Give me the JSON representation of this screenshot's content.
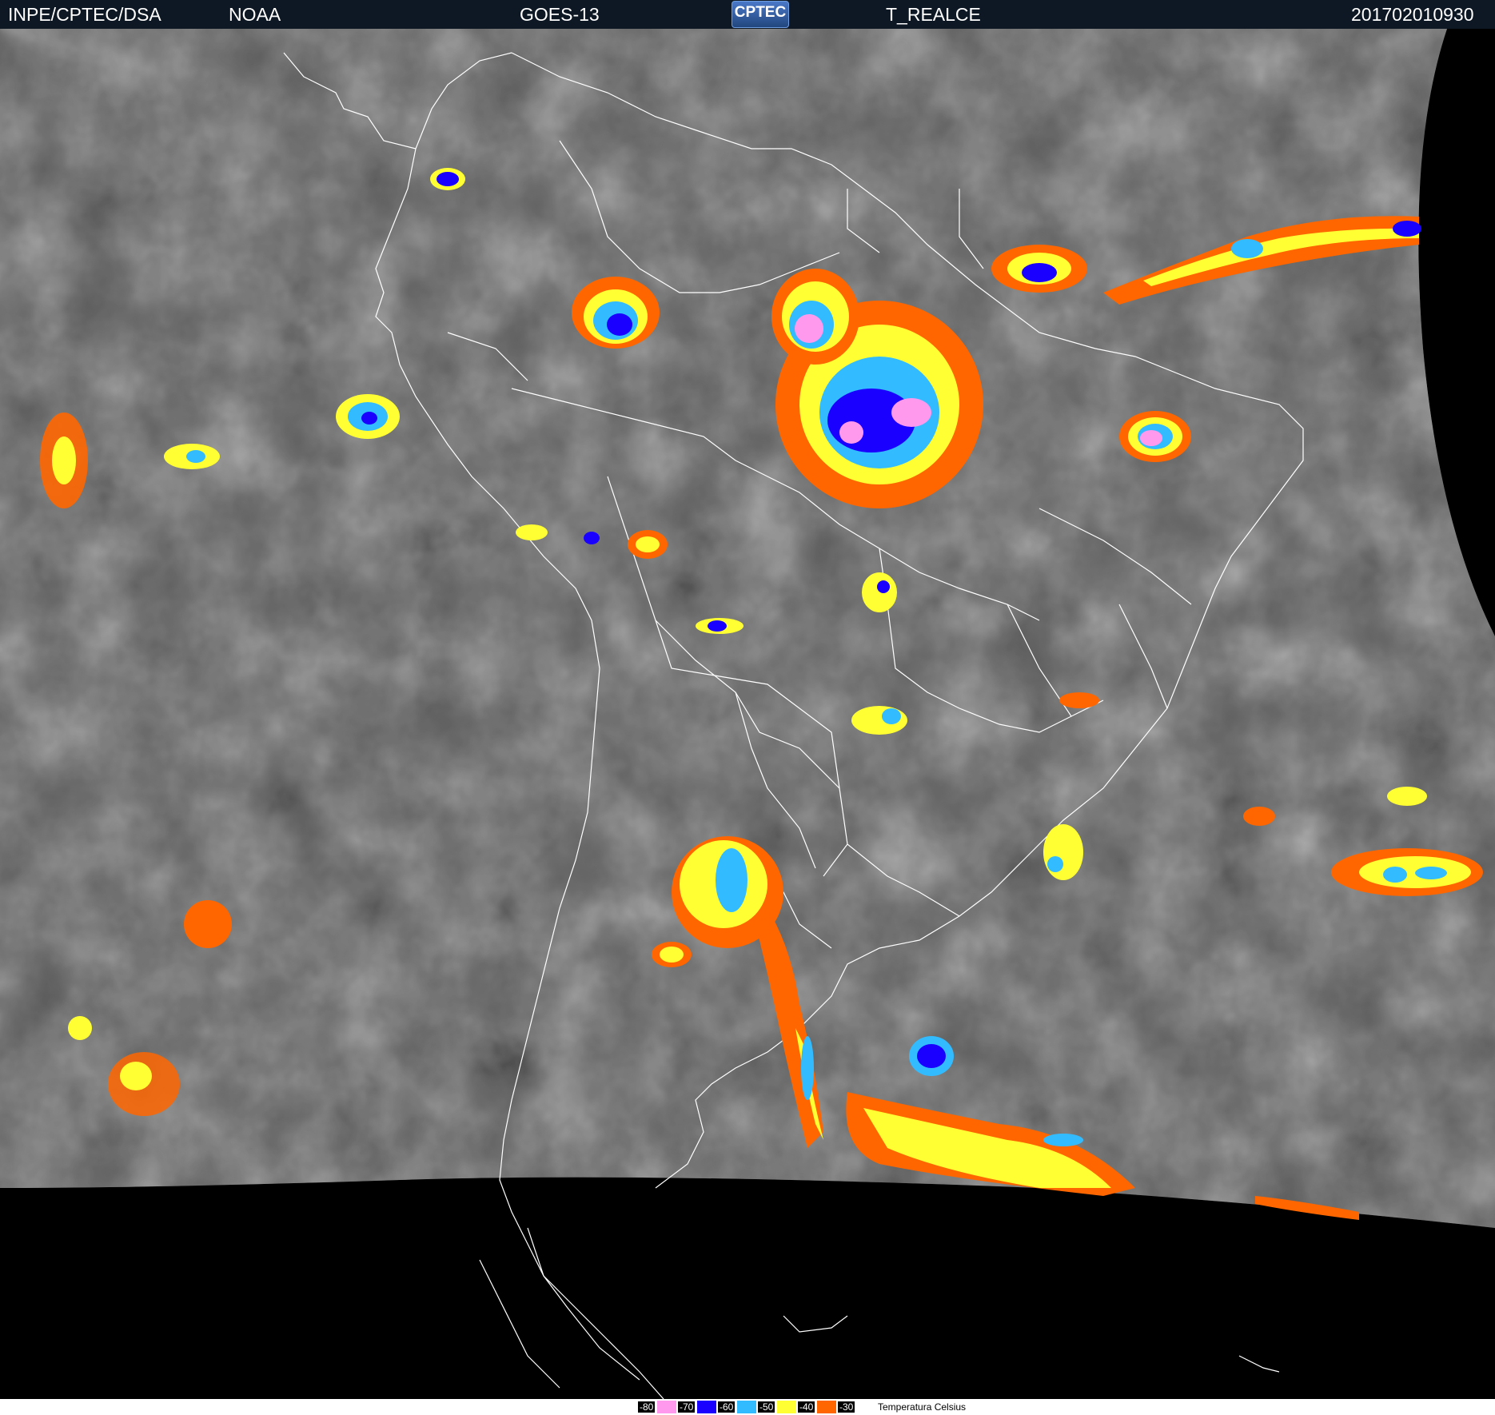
{
  "header": {
    "institution": "INPE/CPTEC/DSA",
    "agency": "NOAA",
    "satellite": "GOES-13",
    "logo_text": "CPTEC",
    "product": "T_REALCE",
    "timestamp": "201702010930"
  },
  "legend": {
    "title": "Temperatura   Celsius",
    "entries": [
      {
        "label": "-80",
        "color": "#ff99ee"
      },
      {
        "label": "-70",
        "color": "#1a00ff"
      },
      {
        "label": "-60",
        "color": "#33bbff"
      },
      {
        "label": "-50",
        "color": "#ffff33"
      },
      {
        "label": "-40",
        "color": "#ff6600"
      },
      {
        "label": "-30",
        "color": "#ffffff"
      }
    ]
  },
  "colors": {
    "header_bg": "#0d1824",
    "cloud_gray": "#5a5a5a",
    "space": "#000000",
    "borders": "#ffffff"
  }
}
